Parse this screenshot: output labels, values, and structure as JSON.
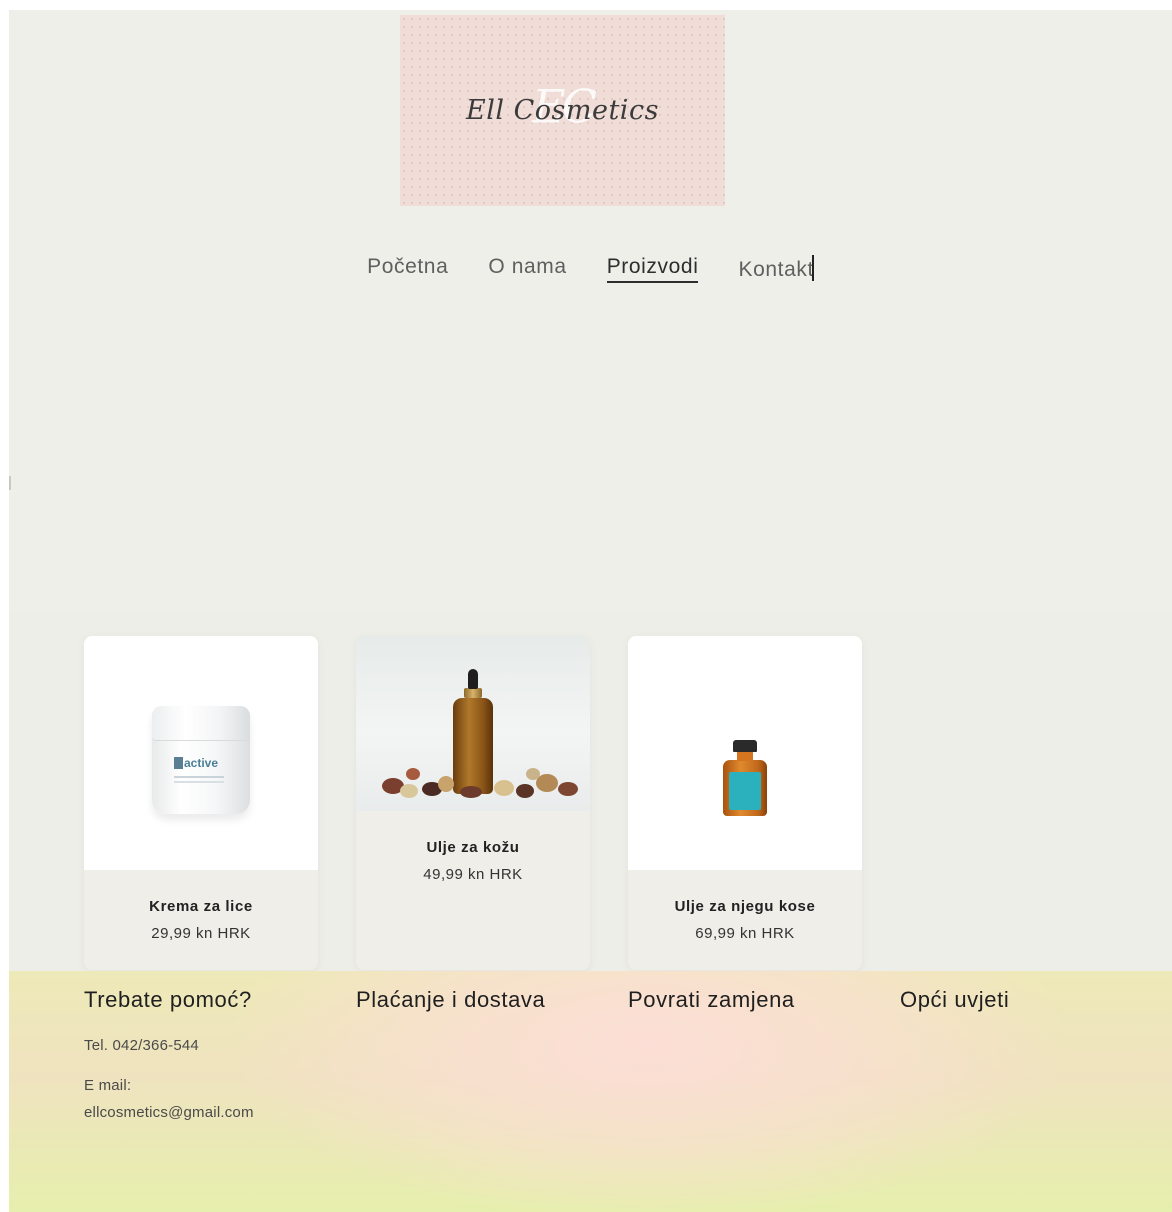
{
  "brand": {
    "logo_text": "Ell Cosmetics",
    "logo_monogram": "EC",
    "logo_bg_color": "#f1ddd8"
  },
  "nav": {
    "items": [
      {
        "label": "Početna",
        "active": false
      },
      {
        "label": "O nama",
        "active": false
      },
      {
        "label": "Proizvodi",
        "active": true
      },
      {
        "label": "Kontakt",
        "active": false
      }
    ]
  },
  "products": [
    {
      "name": "Krema za lice",
      "price": "29,99 kn HRK",
      "image": "face-cream-jar-image",
      "jar_label": "active"
    },
    {
      "name": "Ulje za kožu",
      "price": "49,99 kn HRK",
      "image": "skin-oil-dropper-bottle-image"
    },
    {
      "name": "Ulje za njegu kose",
      "price": "69,99 kn HRK",
      "image": "hair-oil-bottle-image"
    }
  ],
  "footer": {
    "help": {
      "title": "Trebate pomoć?",
      "phone": "Tel. 042/366-544",
      "email_label": "E mail:",
      "email": "ellcosmetics@gmail.com"
    },
    "payment_title": "Plaćanje i dostava",
    "returns_title": "Povrati zamjena",
    "terms_title": "Opći uvjeti"
  },
  "colors": {
    "page_bg": "#efefe9",
    "card_image_bg": "#ffffff",
    "footer_pink": "#fcded6",
    "footer_green": "#e6efad",
    "hair_oil_label": "#2bb0bd"
  }
}
